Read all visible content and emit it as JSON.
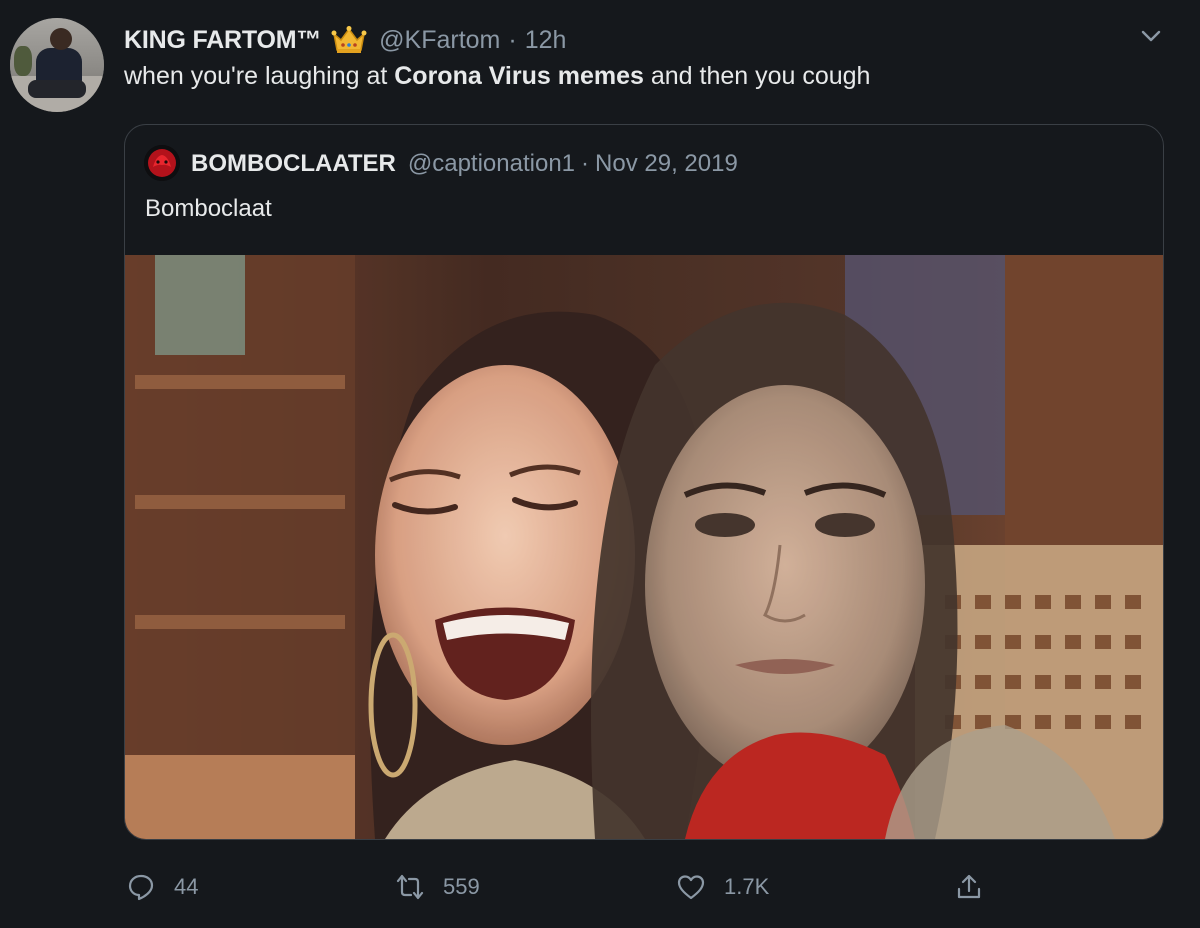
{
  "tweet": {
    "display_name": "KING FARTOM™",
    "badge_icon": "crown-icon",
    "handle": "@KFartom",
    "separator": "·",
    "time": "12h",
    "text_before": "when you're laughing at ",
    "text_bold": "Corona Virus memes",
    "text_after": " and then you cough",
    "menu_icon": "chevron-down-icon"
  },
  "quote": {
    "display_name": "BOMBOCLAATER",
    "handle": "@captionation1",
    "separator": "·",
    "date": "Nov 29, 2019",
    "text": "Bomboclaat",
    "media_icon": "photo"
  },
  "actions": {
    "reply_count": "44",
    "retweet_count": "559",
    "like_count": "1.7K"
  },
  "colors": {
    "background": "#15181c",
    "text_primary": "#e7e9ea",
    "text_secondary": "#8b98a5",
    "border": "#3a3f45"
  }
}
